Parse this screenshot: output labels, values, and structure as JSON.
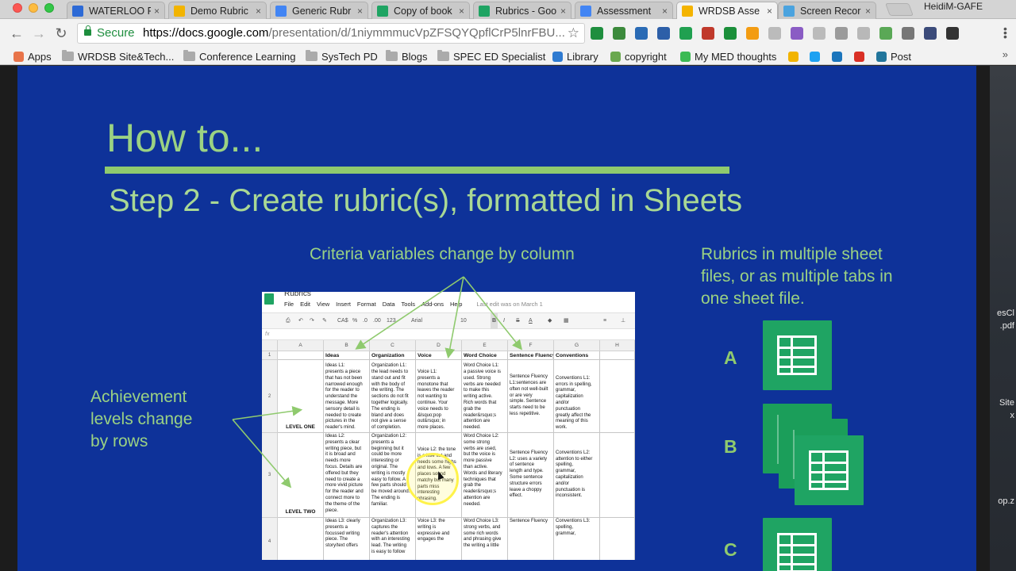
{
  "browser": {
    "tabs": [
      {
        "label": "WATERLOO F",
        "icon": "site-s-icon",
        "color": "#2d6ad6",
        "active": false
      },
      {
        "label": "Demo Rubric",
        "icon": "drive-icon",
        "color": "#f2b400",
        "active": false
      },
      {
        "label": "Generic Rubr",
        "icon": "docs-icon",
        "color": "#4285f4",
        "active": false
      },
      {
        "label": "Copy of book",
        "icon": "sheets-icon",
        "color": "#1fa463",
        "active": false
      },
      {
        "label": "Rubrics - Goo",
        "icon": "sheets-icon",
        "color": "#1fa463",
        "active": false
      },
      {
        "label": "Assessment",
        "icon": "docs-icon",
        "color": "#4285f4",
        "active": false
      },
      {
        "label": "WRDSB Asse",
        "icon": "slides-icon",
        "color": "#f4b400",
        "active": true
      },
      {
        "label": "Screen Recor",
        "icon": "record-icon",
        "color": "#4aa3df",
        "active": false
      }
    ],
    "profile": "HeidiM-GAFE",
    "secure_label": "Secure",
    "url_host": "https://docs.google.com",
    "url_rest": "/presentation/d/1niymmmucVpZFSQYQpflCrP5lnrFBU..."
  },
  "bookmarks": [
    {
      "label": "Apps",
      "icon": "apps-grid-icon"
    },
    {
      "label": "WRDSB Site&Tech...",
      "icon": "folder-icon"
    },
    {
      "label": "Conference Learning",
      "icon": "folder-icon"
    },
    {
      "label": "SysTech PD",
      "icon": "folder-icon"
    },
    {
      "label": "Blogs",
      "icon": "folder-icon"
    },
    {
      "label": "SPEC ED Specialist",
      "icon": "folder-icon"
    },
    {
      "label": "Library",
      "icon": "library-icon"
    },
    {
      "label": "copyright",
      "icon": "copyright-icon"
    },
    {
      "label": "My MED thoughts",
      "icon": "m-icon"
    },
    {
      "label": "",
      "icon": "drive-icon"
    },
    {
      "label": "",
      "icon": "twitter-icon"
    },
    {
      "label": "",
      "icon": "tweetdeck-icon"
    },
    {
      "label": "",
      "icon": "gmail-icon"
    },
    {
      "label": "Post",
      "icon": "wordpress-icon"
    }
  ],
  "desktop": {
    "item1": "esCl",
    "item2": ".pdf",
    "item3": "Site",
    "item4": "x",
    "item5": "op.z"
  },
  "slide": {
    "title": "How to...",
    "subtitle": "Step 2 - Create rubric(s), formatted in Sheets",
    "callout_columns": "Criteria variables change by column",
    "callout_rows": [
      "Achievement",
      "levels change",
      "by rows"
    ],
    "callout_files": [
      "Rubrics in multiple sheet",
      "files, or as multiple tabs in",
      "one sheet file."
    ],
    "tier_a": "A",
    "tier_b": "B",
    "tier_c": "C"
  },
  "sheet": {
    "doc_name": "Rubrics",
    "menu": [
      "File",
      "Edit",
      "View",
      "Insert",
      "Format",
      "Data",
      "Tools",
      "Add-ons",
      "Help"
    ],
    "last_edit": "Last edit was on March 1",
    "font": "Arial",
    "font_size": "10",
    "currency": "CA$",
    "percent": "%",
    "decimals": ".0",
    "decimals2": ".00",
    "numfmt": "123",
    "fx": "fx",
    "col_letters": [
      "A",
      "B",
      "C",
      "D",
      "E",
      "F",
      "G",
      "H"
    ],
    "row_numbers": [
      "1",
      "2",
      "3",
      "4"
    ],
    "headers": [
      "",
      "Ideas",
      "Organization",
      "Voice",
      "Word Choice",
      "Sentence Fluency",
      "Conventions"
    ],
    "rows": [
      {
        "level": "LEVEL ONE",
        "cells": [
          "Ideas L1:\npresents a piece\nthat has not been\nnarrowed enough\nfor the reader to\nunderstand the\nmessage. More\nsensory detail is\nneeded to create\npictures in the\nreader's mind.",
          "Organization L1:\nthe lead needs to\nstand out and fit\nwith the body of\nthe writing. The\nsections do not fit\ntogether logically.\nThe ending is\nbland and does\nnot give a sense\nof completion.",
          "Voice L1:\npresents a\nmonotone that\nleaves the reader\nnot wanting to\ncontinue. Your\nvoice needs to\n&lsquo;pop\nout&rsquo; in\nmore places.",
          "Word Choice L1:\na passive voice is\nused. Strong\nverbs are needed\nto make this\nwriting active.\nRich words that\ngrab the\nreader&rsquo;s\nattention are\nneeded.",
          "Sentence Fluency\nL1:sentences are\noften not well-built\nor are very\nsimple. Sentence\nstarts need to be\nless repetitive.",
          "Conventions L1:\nerrors in spelling,\ngrammar,\ncapitalization\nand/or\npunctuation\ngreatly affect the\nmeaning of this\nwork."
        ]
      },
      {
        "level": "LEVEL TWO",
        "cells": [
          "Ideas L2:\npresents a clear\nwriting piece, but\nit is broad and\nneeds more\nfocus. Details are\noffered but they\nneed to create a\nmore vivid picture\nfor the reader and\nconnect more to\nthe theme of the\npiece.",
          "Organization L2:\npresents a\nbeginning but it\ncould be more\ninteresting or\noriginal. The\nwriting is mostly\neasy to follow. A\nfew parts should\nbe moved around.\nThe ending is\nfamiliar.",
          "Voice L2: the tone\nis a little flat and\nneeds some highs\nand lows. A few\nplaces sound\nmatchy but many\nparts miss\ninteresting\nphrasing.",
          "Word Choice L2:\nsome strong\nverbs are used,\nbut the voice is\nmore passive\nthan active.\nWords and literary\ntechniques that\ngrab the\nreader&rsquo;s\nattention are\nneeded.",
          "Sentence Fluency\nL2: uses a variety\nof sentence\nlength and type.\nSome sentence\nstructure errors\nleave a choppy\neffect.",
          "Conventions L2:\nattention to either\nspelling,\ngrammar,\ncapitalization\nand/or\npunctuation is\ninconsistent."
        ]
      },
      {
        "level": "",
        "cells": [
          "Ideas L3: clearly\npresents a\nfocussed writing\npiece. The\nstory/text offers",
          "Organization L3:\ncaptures the\nreader's attention\nwith an interesting\nlead. The writing\nis easy to follow",
          "Voice L3: the\nwriting is\nexpressive and\nengages the",
          "Word Choice L3:\nstrong verbs, and\nsome rich words\nand phrasing give\nthe writing a little",
          "Sentence Fluency",
          "Conventions L3:\nspelling,\ngrammar,"
        ]
      }
    ]
  }
}
